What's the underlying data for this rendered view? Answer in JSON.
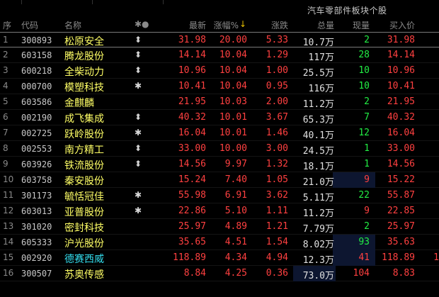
{
  "panel": {
    "title": "汽车零部件板块个股"
  },
  "columns": {
    "idx": "序",
    "code": "代码",
    "name": "名称",
    "mark": "✱●",
    "price": "最新",
    "pct": "涨幅%",
    "pct_sort": "↓",
    "chg": "涨跌",
    "vol": "总量",
    "cur": "现量",
    "bid": "买入价"
  },
  "colors": {
    "up": "#ff4040",
    "down": "#22ee44",
    "name": "#ffff66",
    "highlight_name": "#33ddee",
    "bg": "#000000"
  },
  "rows": [
    {
      "idx": "1",
      "code": "300893",
      "name": "松原安全",
      "mark": "⬍",
      "price": "31.98",
      "pct": "20.00",
      "chg": "5.33",
      "vol": "10.7万",
      "cur": "2",
      "cur_dir": "down",
      "bid": "31.98"
    },
    {
      "idx": "2",
      "code": "603158",
      "name": "腾龙股份",
      "mark": "⬍",
      "price": "14.14",
      "pct": "10.04",
      "chg": "1.29",
      "vol": "117万",
      "cur": "28",
      "cur_dir": "down",
      "bid": "14.14"
    },
    {
      "idx": "3",
      "code": "600218",
      "name": "全柴动力",
      "mark": "⬍",
      "price": "10.96",
      "pct": "10.04",
      "chg": "1.00",
      "vol": "25.5万",
      "cur": "10",
      "cur_dir": "down",
      "bid": "10.96"
    },
    {
      "idx": "4",
      "code": "000700",
      "name": "模塑科技",
      "mark": "✱",
      "price": "10.41",
      "pct": "10.04",
      "chg": "0.95",
      "vol": "116万",
      "cur": "10",
      "cur_dir": "down",
      "bid": "10.41"
    },
    {
      "idx": "5",
      "code": "603586",
      "name": "金麒麟",
      "mark": "",
      "price": "21.95",
      "pct": "10.03",
      "chg": "2.00",
      "vol": "11.2万",
      "cur": "2",
      "cur_dir": "down",
      "bid": "21.95"
    },
    {
      "idx": "6",
      "code": "002190",
      "name": "成飞集成",
      "mark": "⬍",
      "price": "40.32",
      "pct": "10.01",
      "chg": "3.67",
      "vol": "65.3万",
      "cur": "7",
      "cur_dir": "down",
      "bid": "40.32"
    },
    {
      "idx": "7",
      "code": "002725",
      "name": "跃岭股份",
      "mark": "✱",
      "price": "16.04",
      "pct": "10.01",
      "chg": "1.46",
      "vol": "40.1万",
      "cur": "12",
      "cur_dir": "down",
      "bid": "16.04"
    },
    {
      "idx": "8",
      "code": "002553",
      "name": "南方精工",
      "mark": "⬍",
      "price": "33.00",
      "pct": "10.00",
      "chg": "3.00",
      "vol": "24.5万",
      "cur": "1",
      "cur_dir": "down",
      "bid": "33.00"
    },
    {
      "idx": "9",
      "code": "603926",
      "name": "铁流股份",
      "mark": "⬍",
      "price": "14.56",
      "pct": "9.97",
      "chg": "1.32",
      "vol": "18.1万",
      "cur": "1",
      "cur_dir": "down",
      "bid": "14.56"
    },
    {
      "idx": "10",
      "code": "603758",
      "name": "秦安股份",
      "mark": "",
      "price": "15.24",
      "pct": "7.40",
      "chg": "1.05",
      "vol": "21.0万",
      "cur": "9",
      "cur_dir": "up",
      "bid": "15.22"
    },
    {
      "idx": "11",
      "code": "301173",
      "name": "毓恬冠佳",
      "mark": "✱",
      "price": "55.98",
      "pct": "6.91",
      "chg": "3.62",
      "vol": "5.11万",
      "cur": "22",
      "cur_dir": "down",
      "bid": "55.87"
    },
    {
      "idx": "12",
      "code": "603013",
      "name": "亚普股份",
      "mark": "✱",
      "price": "22.86",
      "pct": "5.10",
      "chg": "1.11",
      "vol": "11.2万",
      "cur": "9",
      "cur_dir": "up",
      "bid": "22.85"
    },
    {
      "idx": "13",
      "code": "301020",
      "name": "密封科技",
      "mark": "",
      "price": "25.97",
      "pct": "4.89",
      "chg": "1.21",
      "vol": "7.79万",
      "cur": "2",
      "cur_dir": "down",
      "bid": "25.97"
    },
    {
      "idx": "14",
      "code": "605333",
      "name": "沪光股份",
      "mark": "",
      "price": "35.65",
      "pct": "4.51",
      "chg": "1.54",
      "vol": "8.02万",
      "cur": "93",
      "cur_dir": "down",
      "bid": "35.63"
    },
    {
      "idx": "15",
      "code": "002920",
      "name": "德赛西威",
      "mark": "",
      "price": "118.89",
      "pct": "4.34",
      "chg": "4.94",
      "vol": "12.3万",
      "cur": "41",
      "cur_dir": "up",
      "bid": "118.89",
      "extra": "1"
    },
    {
      "idx": "16",
      "code": "300507",
      "name": "苏奥传感",
      "mark": "",
      "price": "8.84",
      "pct": "4.25",
      "chg": "0.36",
      "vol": "73.0万",
      "cur": "104",
      "cur_dir": "up",
      "bid": "8.83"
    }
  ]
}
